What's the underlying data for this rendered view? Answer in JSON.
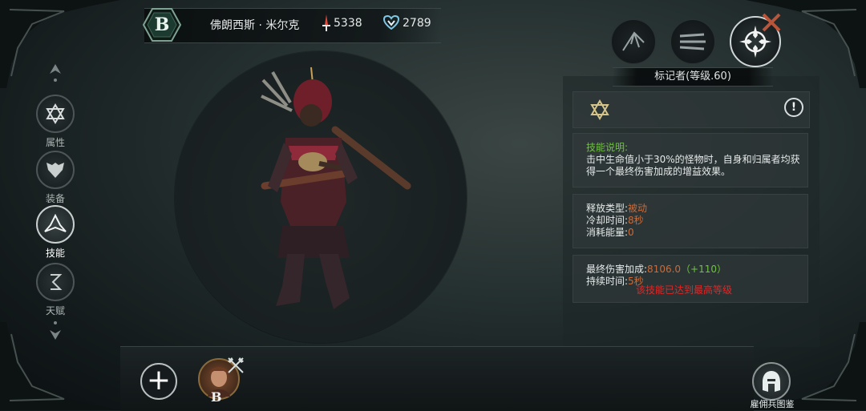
{
  "header": {
    "rank": "B",
    "hero_name": "佛朗西斯 · 米尔克",
    "attack_value": "5338",
    "defense_value": "2789"
  },
  "nav": {
    "items": [
      {
        "label": "属性",
        "icon": "star-of-david-icon",
        "active": false
      },
      {
        "label": "装备",
        "icon": "armor-icon",
        "active": false
      },
      {
        "label": "技能",
        "icon": "skill-icon",
        "active": true
      },
      {
        "label": "天赋",
        "icon": "talent-icon",
        "active": false
      }
    ]
  },
  "skill": {
    "tabs": [
      "arrow-rain-icon",
      "multi-arrow-icon",
      "marker-crosshair-icon"
    ],
    "title": "标记者(等级.60)",
    "desc_heading": "技能说明:",
    "desc_text": "击中生命值小于30%的怪物时，自身和归属者均获得一个最终伤害加成的增益效果。",
    "release_type_label": "释放类型:",
    "release_type_value": "被动",
    "cooldown_label": "冷却时间:",
    "cooldown_value": "8秒",
    "energy_label": "消耗能量:",
    "energy_value": "0",
    "final_damage_label": "最终伤害加成:",
    "final_damage_value": "8106.0",
    "final_damage_bonus": "（+110）",
    "duration_label": "持续时间:",
    "duration_value": "5秒",
    "max_level_notice": "该技能已达到最高等级"
  },
  "bottom": {
    "add_symbol": "+",
    "merc_rank": "B",
    "gallery_label": "雇佣兵图鉴"
  },
  "colors": {
    "accent_value": "#c96b3a",
    "heading_green": "#71c243",
    "warning_red": "#e22626"
  }
}
